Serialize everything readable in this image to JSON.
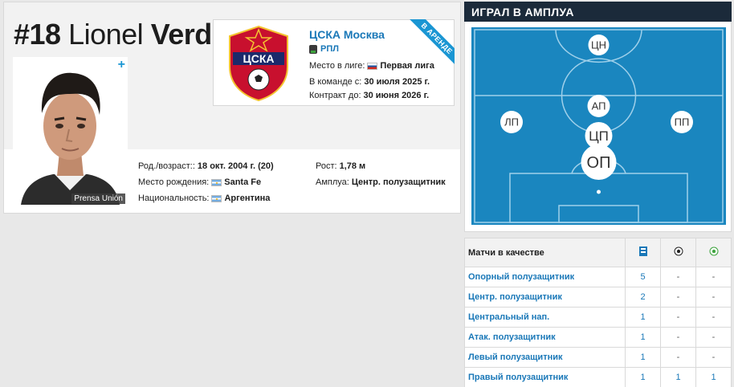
{
  "player": {
    "number": "#18",
    "first_name": "Lionel",
    "last_name": "Verde",
    "photo_caption": "Prensa Unión",
    "photo_add": "+"
  },
  "club": {
    "name": "ЦСКА Москва",
    "league": "РПЛ",
    "loan_badge": "В АРЕНДЕ",
    "league_level_label": "Место в лиге:",
    "league_level_value": "Первая лига",
    "joined_label": "В команде с:",
    "joined_value": "30 июля 2025 г.",
    "contract_label": "Контракт до:",
    "contract_value": "30 июня 2026 г.",
    "logo_text": "ЦСКА"
  },
  "facts": {
    "birth_label": "Род./возраст::",
    "birth_value": "18 окт. 2004 г. (20)",
    "birthplace_label": "Место рождения:",
    "birthplace_value": "Santa Fe",
    "nationality_label": "Национальность:",
    "nationality_value": "Аргентина",
    "height_label": "Рост:",
    "height_value": "1,78 м",
    "position_label": "Амплуа:",
    "position_value": "Центр. полузащитник"
  },
  "positions_panel": {
    "title": "ИГРАЛ В АМПЛУА",
    "pitch_markers": [
      {
        "label": "ЦН",
        "size": "small"
      },
      {
        "label": "АП",
        "size": "small"
      },
      {
        "label": "ЛП",
        "size": "small"
      },
      {
        "label": "ПП",
        "size": "small"
      },
      {
        "label": "ЦП",
        "size": "medium"
      },
      {
        "label": "ОП",
        "size": "large"
      }
    ],
    "table_header": "Матчи в качестве",
    "column_icons": [
      "appearances-icon",
      "goal-icon",
      "assist-icon"
    ],
    "rows": [
      {
        "position": "Опорный полузащитник",
        "apps": "5",
        "goals": "-",
        "assists": "-"
      },
      {
        "position": "Центр. полузащитник",
        "apps": "2",
        "goals": "-",
        "assists": "-"
      },
      {
        "position": "Центральный нап.",
        "apps": "1",
        "goals": "-",
        "assists": "-"
      },
      {
        "position": "Атак. полузащитник",
        "apps": "1",
        "goals": "-",
        "assists": "-"
      },
      {
        "position": "Левый полузащитник",
        "apps": "1",
        "goals": "-",
        "assists": "-"
      },
      {
        "position": "Правый полузащитник",
        "apps": "1",
        "goals": "1",
        "assists": "1"
      }
    ]
  },
  "colors": {
    "pitch": "#1a86bf",
    "accent": "#1a96d3",
    "link": "#1a78b8",
    "panel_header": "#1b2a3a"
  }
}
